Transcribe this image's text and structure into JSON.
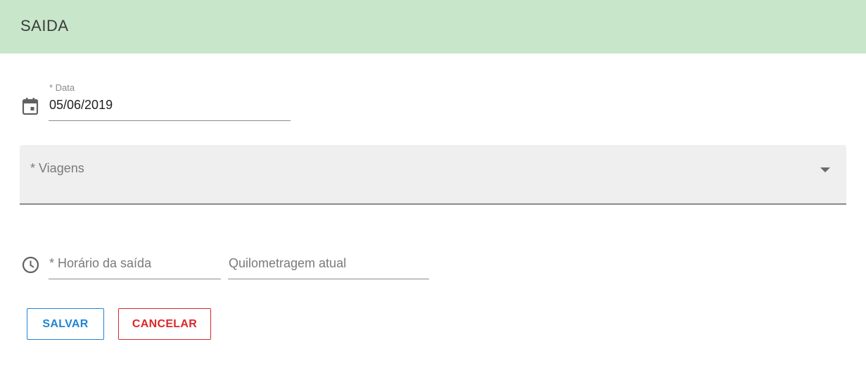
{
  "header": {
    "title": "SAIDA",
    "background": "#c8e6c9"
  },
  "form": {
    "date": {
      "label": "* Data",
      "value": "05/06/2019",
      "icon": "calendar-icon"
    },
    "trips": {
      "placeholder": "* Viagens",
      "icon": "dropdown-arrow-icon"
    },
    "departure_time": {
      "placeholder": "* Horário da saída",
      "icon": "clock-icon"
    },
    "current_mileage": {
      "placeholder": "Quilometragem atual"
    }
  },
  "actions": {
    "save_label": "SALVAR",
    "save_color": "#2185d0",
    "cancel_label": "CANCELAR",
    "cancel_color": "#db2828"
  }
}
